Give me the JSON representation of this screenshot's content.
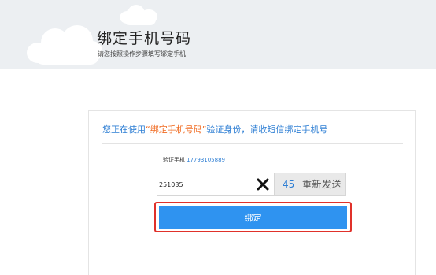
{
  "header": {
    "title": "绑定手机号码",
    "subtitle": "请您按照操作步骤填写绑定手机"
  },
  "notice": {
    "prefix": "您正在使用",
    "method": "“绑定手机号码”",
    "suffix": "验证身份，请收短信绑定手机号"
  },
  "phone": {
    "label": "验证手机",
    "number": "17793105889"
  },
  "code_input": {
    "value": "251035",
    "clear_icon": "close-x-icon"
  },
  "resend": {
    "countdown": "45",
    "label": "重新发送"
  },
  "submit": {
    "label": "绑定"
  },
  "colors": {
    "header_bg": "#eceff2",
    "link_blue": "#2f7fd4",
    "highlight_orange": "#f06b22",
    "button_blue": "#2f93f0",
    "focus_red": "#e0312a"
  }
}
